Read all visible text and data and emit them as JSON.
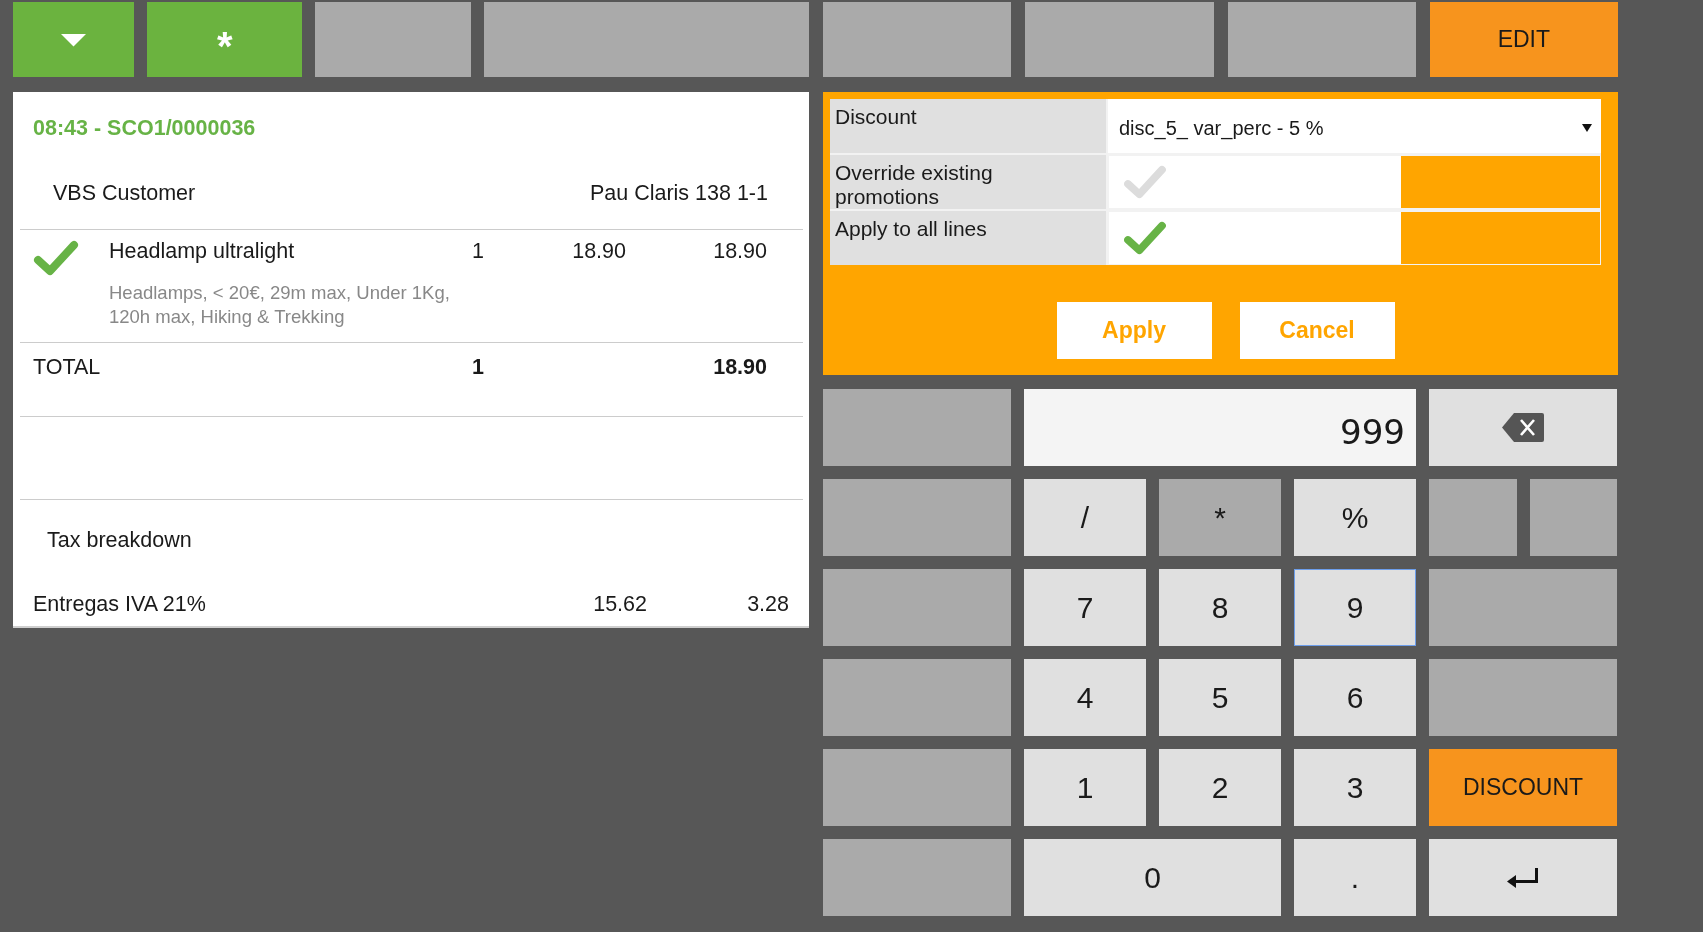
{
  "toolbar": {
    "left": [
      {
        "kind": "dropdown",
        "disabled": false
      },
      {
        "kind": "symbol",
        "label": "*",
        "disabled": false
      },
      {
        "kind": "blank",
        "disabled": true
      },
      {
        "kind": "blank",
        "disabled": true
      }
    ],
    "right": [
      {
        "kind": "blank",
        "disabled": true
      },
      {
        "kind": "blank",
        "disabled": true
      },
      {
        "kind": "blank",
        "disabled": true
      },
      {
        "kind": "action",
        "label": "EDIT",
        "disabled": false
      }
    ]
  },
  "receipt": {
    "title": "08:43 - SCO1/0000036",
    "customer": "VBS Customer",
    "address": "Pau Claris 138 1-1",
    "lines": [
      {
        "checked": true,
        "name": "Headlamp ultralight",
        "quantity": "1",
        "price": "18.90",
        "amount": "18.90",
        "description": "Headlamps, < 20€, 29m max, Under 1Kg, 120h max, Hiking & Trekking"
      }
    ],
    "total": {
      "label": "TOTAL",
      "quantity": "1",
      "amount": "18.90"
    },
    "tax": {
      "title": "Tax breakdown",
      "rows": [
        {
          "name": "Entregas IVA 21%",
          "base": "15.62",
          "amount": "3.28"
        }
      ]
    }
  },
  "discount_form": {
    "fields": [
      {
        "kind": "select",
        "label": "Discount",
        "value": "disc_5_ var_perc - 5 %"
      },
      {
        "kind": "checkbox",
        "label": "Override existing promotions",
        "checked": false
      },
      {
        "kind": "checkbox",
        "label": "Apply to all lines",
        "checked": true
      }
    ],
    "buttons": [
      "Apply",
      "Cancel"
    ]
  },
  "keypad": {
    "keys": [
      {
        "kind": "wide",
        "disabled": true,
        "focused": false
      },
      {
        "kind": "display",
        "value": "999",
        "disabled": false,
        "focused": false
      },
      {
        "kind": "backspace",
        "disabled": false,
        "focused": false
      },
      {
        "kind": "wide",
        "disabled": true,
        "focused": false
      },
      {
        "kind": "key",
        "label": "/",
        "disabled": false,
        "focused": false
      },
      {
        "kind": "key",
        "label": "*",
        "disabled": true,
        "focused": false
      },
      {
        "kind": "key",
        "label": "%",
        "disabled": false,
        "focused": false
      },
      {
        "kind": "key",
        "disabled": true,
        "focused": false
      },
      {
        "kind": "key",
        "disabled": true,
        "focused": false
      },
      {
        "kind": "wide",
        "disabled": true,
        "focused": false
      },
      {
        "kind": "key",
        "label": "7",
        "disabled": false,
        "focused": false
      },
      {
        "kind": "key",
        "label": "8",
        "disabled": false,
        "focused": false
      },
      {
        "kind": "key",
        "label": "9",
        "disabled": false,
        "focused": true
      },
      {
        "kind": "wide",
        "disabled": true,
        "focused": false
      },
      {
        "kind": "wide",
        "disabled": true,
        "focused": false
      },
      {
        "kind": "key",
        "label": "4",
        "disabled": false,
        "focused": false
      },
      {
        "kind": "key",
        "label": "5",
        "disabled": false,
        "focused": false
      },
      {
        "kind": "key",
        "label": "6",
        "disabled": false,
        "focused": false
      },
      {
        "kind": "wide",
        "disabled": true,
        "focused": false
      },
      {
        "kind": "wide",
        "disabled": true,
        "focused": false
      },
      {
        "kind": "key",
        "label": "1",
        "disabled": false,
        "focused": false
      },
      {
        "kind": "key",
        "label": "2",
        "disabled": false,
        "focused": false
      },
      {
        "kind": "key",
        "label": "3",
        "disabled": false,
        "focused": false
      },
      {
        "kind": "action",
        "label": "DISCOUNT",
        "disabled": false,
        "focused": false
      },
      {
        "kind": "wide",
        "disabled": true,
        "focused": false
      },
      {
        "kind": "wide",
        "label": "0",
        "disabled": false,
        "focused": false
      },
      {
        "kind": "key",
        "label": ".",
        "disabled": false,
        "focused": false
      },
      {
        "kind": "enter",
        "disabled": false,
        "focused": false
      }
    ]
  }
}
